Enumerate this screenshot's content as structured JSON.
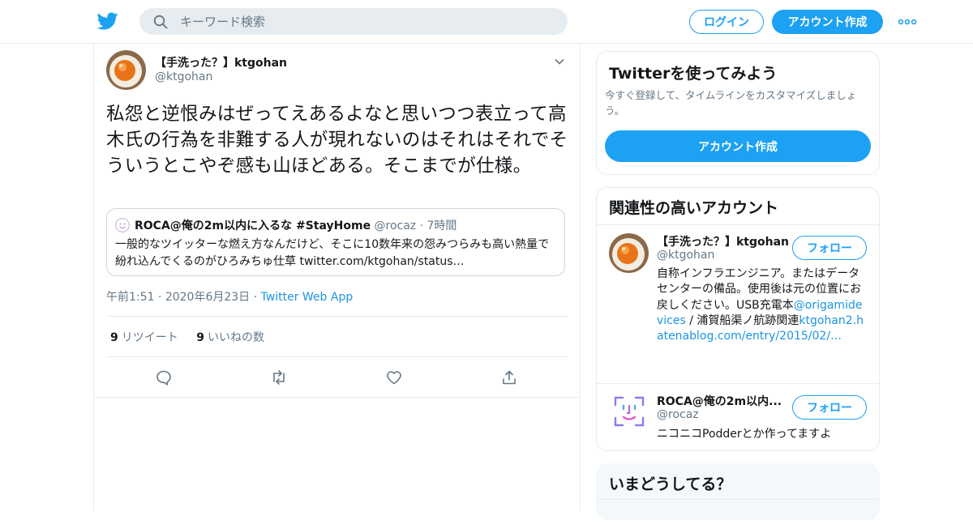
{
  "header": {
    "search_placeholder": "キーワード検索",
    "login_label": "ログイン",
    "signup_label": "アカウント作成"
  },
  "tweet": {
    "author_name": "【手洗った？】ktgohan",
    "author_handle": "@ktgohan",
    "text": "私怨と逆恨みはぜってえあるよなと思いつつ表立って高木氏の行為を非難する人が現れないのはそれはそれでそういうとこやぞ感も山ほどある。そこまでが仕様。",
    "quote": {
      "author_name": "ROCA@俺の2m以内に入るな #StayHome",
      "author_handle": "@rocaz",
      "time": "7時間",
      "text": "一般的なツイッターな燃え方なんだけど、そこに10数年来の怨みつらみも高い熱量で紛れ込んでくるのがひろみちゅ仕草 twitter.com/ktgohan/status…"
    },
    "time": "午前1:51",
    "date": "2020年6月23日",
    "source": "Twitter Web App",
    "retweet_count": "9",
    "retweet_label": "リツイート",
    "like_count": "9",
    "like_label": "いいねの数"
  },
  "signup_card": {
    "title": "Twitterを使ってみよう",
    "subtitle": "今すぐ登録して、タイムラインをカスタマイズしましょう。",
    "button_label": "アカウント作成"
  },
  "related": {
    "title": "関連性の高いアカウント",
    "accounts": [
      {
        "name": "【手洗った？】ktgohan",
        "handle": "@ktgohan",
        "follow_label": "フォロー",
        "bio_text_1": "自称インフラエンジニア。またはデータセンターの備品。使用後は元の位置にお戻しください。USB充電本",
        "bio_link_1": "@origamidevices",
        "bio_text_2": " / 浦賀船渠ノ航跡関連",
        "bio_link_2": "ktgohan2.hatenablog.com/entry/2015/02/…"
      },
      {
        "name": "ROCA@俺の2m以内...",
        "handle": "@rocaz",
        "follow_label": "フォロー",
        "bio": "ニコニコPodderとか作ってますよ"
      }
    ]
  },
  "trends": {
    "title": "いまどうしてる？"
  },
  "colors": {
    "accent": "#1da1f2",
    "link": "#1b95e0",
    "muted": "#657786",
    "border": "#e6ecf0"
  },
  "icons": [
    "twitter-bird-icon",
    "search-icon",
    "more-icon",
    "chevron-down-icon",
    "reply-icon",
    "retweet-icon",
    "like-icon",
    "share-icon"
  ]
}
